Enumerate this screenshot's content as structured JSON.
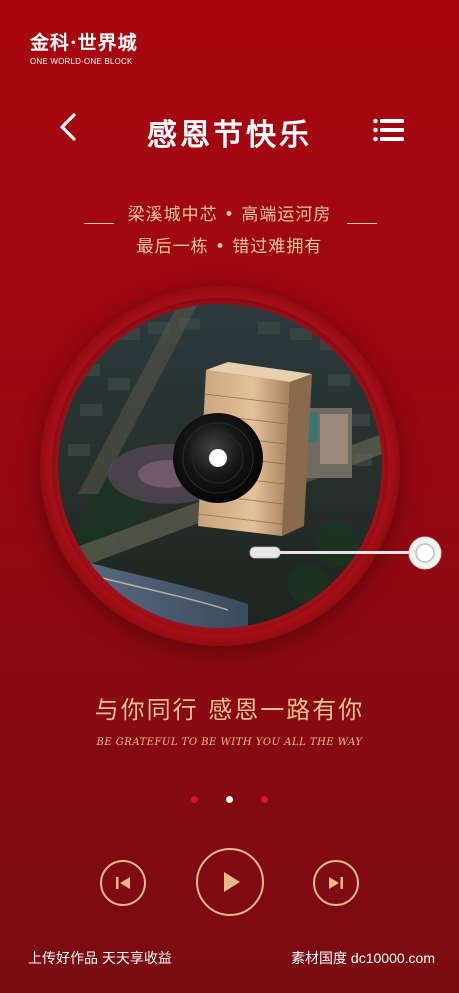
{
  "brand": {
    "title": "金科·世界城",
    "subtitle": "ONE WORLD·ONE BLOCK"
  },
  "nav": {
    "title": "感恩节快乐"
  },
  "tagline": {
    "line1": "梁溪城中芯 • 高端运河房",
    "line2": "最后一栋 • 错过难拥有"
  },
  "slogan": {
    "cn": "与你同行 感恩一路有你",
    "en": "BE GRATEFUL TO BE WITH YOU ALL THE WAY"
  },
  "pager": {
    "count": 3,
    "active_index": 1
  },
  "footer": {
    "left": "上传好作品 天天享收益",
    "right": "素材国度 dc10000.com"
  },
  "colors": {
    "background": "#9c0710",
    "accent_gold": "#f0c08d",
    "dot_inactive": "#e0141c",
    "dot_active": "#ffffff"
  },
  "icons": {
    "back": "chevron-left-icon",
    "menu": "hamburger-menu-icon",
    "prev": "skip-previous-icon",
    "play": "play-icon",
    "next": "skip-next-icon"
  }
}
